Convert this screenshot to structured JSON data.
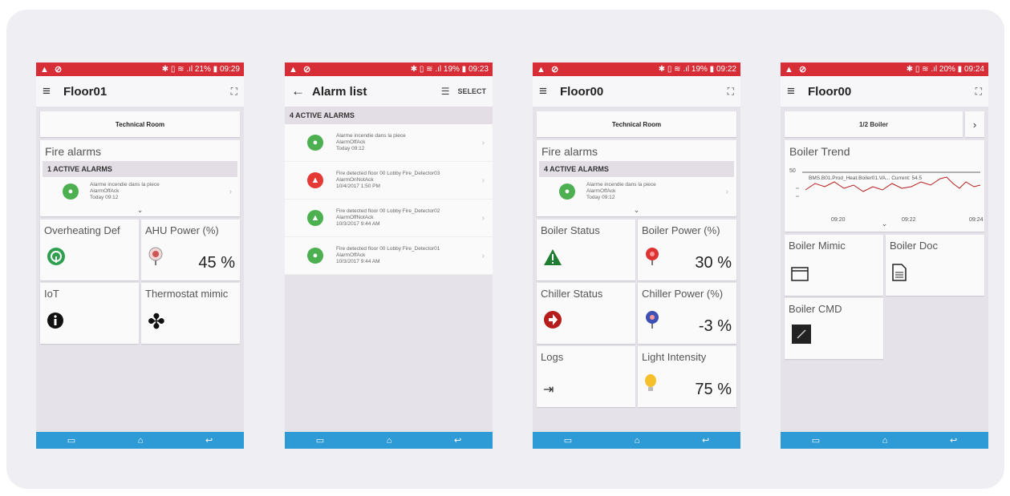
{
  "colors": {
    "statusbar": "#d62d36",
    "navbar": "#2f9bd6",
    "alarm_green": "#4caf50",
    "alarm_red": "#e53935"
  },
  "screens": [
    {
      "status": {
        "left": "▲ ⊘",
        "right": "✱ ▯ ≋ .ıl 21% ▮ 09:29"
      },
      "title": "Floor01",
      "banner": "Technical Room",
      "fire": {
        "heading": "Fire alarms",
        "count": "1 ACTIVE ALARMS",
        "alarm": {
          "line1": "Alarme incendie dans la piece",
          "line2": "AlarmOffAck",
          "line3": "Today 09:12"
        }
      },
      "tiles": [
        {
          "title": "Overheating Def",
          "icon": "gauge-icon",
          "value": ""
        },
        {
          "title": "AHU Power (%)",
          "icon": "meter-icon",
          "value": "45 %"
        },
        {
          "title": "IoT",
          "icon": "info-icon",
          "value": ""
        },
        {
          "title": "Thermostat mimic",
          "icon": "fan-icon",
          "value": ""
        }
      ]
    },
    {
      "status": {
        "left": "▲ ⊘",
        "right": "✱ ▯ ≋ .ıl 19% ▮ 09:23"
      },
      "title": "Alarm list",
      "select_label": "SELECT",
      "count": "4 ACTIVE ALARMS",
      "alarms": [
        {
          "line1": "Alarme incendie dans la piece",
          "line2": "AlarmOffAck",
          "line3": "Today 09:12",
          "color": "#4caf50"
        },
        {
          "line1": "Fire detected floor 00 Lobby Fire_Detector03",
          "line2": "AlarmOnNotAck",
          "line3": "10/4/2017 1:50 PM",
          "color": "#e53935"
        },
        {
          "line1": "Fire detected floor 00 Lobby Fire_Detector02",
          "line2": "AlarmOffNotAck",
          "line3": "10/3/2017 9:44 AM",
          "color": "#4caf50"
        },
        {
          "line1": "Fire detected floor 00 Lobby Fire_Detector01",
          "line2": "AlarmOffAck",
          "line3": "10/3/2017 9:44 AM",
          "color": "#4caf50"
        }
      ]
    },
    {
      "status": {
        "left": "▲ ⊘",
        "right": "✱ ▯ ≋ .ıl 19% ▮ 09:22"
      },
      "title": "Floor00",
      "banner": "Technical Room",
      "fire": {
        "heading": "Fire alarms",
        "count": "4 ACTIVE ALARMS",
        "alarm": {
          "line1": "Alarme incendie dans la piece",
          "line2": "AlarmOffAck",
          "line3": "Today 09:12"
        }
      },
      "tiles": [
        {
          "title": "Boiler Status",
          "icon": "warning-icon",
          "value": ""
        },
        {
          "title": "Boiler Power (%)",
          "icon": "meter-icon",
          "value": "30 %"
        },
        {
          "title": "Chiller Status",
          "icon": "chiller-icon",
          "value": ""
        },
        {
          "title": "Chiller Power (%)",
          "icon": "meter-icon",
          "value": "-3 %"
        },
        {
          "title": "Logs",
          "icon": "logs-icon",
          "value": ""
        },
        {
          "title": "Light Intensity",
          "icon": "bulb-icon",
          "value": "75 %"
        }
      ]
    },
    {
      "status": {
        "left": "▲ ⊘",
        "right": "✱ ▯ ≋ .ıl 20% ▮ 09:24"
      },
      "title": "Floor00",
      "banner": "1/2 Boiler",
      "trend": {
        "heading": "Boiler Trend",
        "y_tick": "50",
        "legend": "BMS.B01.Prod_Heat.Boiler01.VA...   Current: 54.5",
        "x_ticks": [
          "09:20",
          "09:22",
          "09:24"
        ]
      },
      "tiles": [
        {
          "title": "Boiler Mimic",
          "icon": "window-icon",
          "value": ""
        },
        {
          "title": "Boiler Doc",
          "icon": "document-icon",
          "value": ""
        },
        {
          "title": "Boiler CMD",
          "icon": "command-icon",
          "value": ""
        }
      ]
    }
  ]
}
